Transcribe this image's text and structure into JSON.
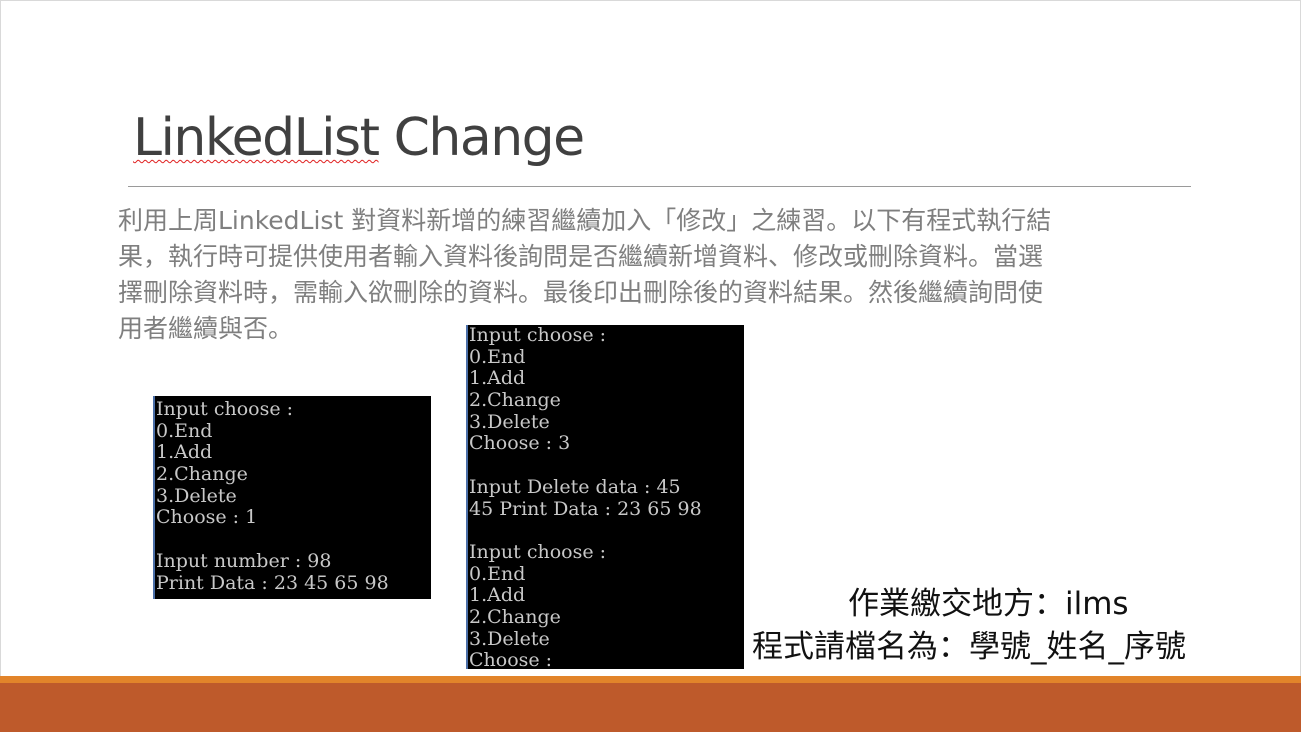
{
  "slide": {
    "title_underlined": "LinkedList",
    "title_rest": " Change",
    "body_lines": [
      "利用上周LinkedList 對資料新增的練習繼續加入「修改」之練習。以下有程式執行結",
      "果，執行時可提供使用者輸入資料後詢問是否繼續新增資料、修改或刪除資料。當選",
      "擇刪除資料時，需輸入欲刪除的資料。最後印出刪除後的資料結果。然後繼續詢問使",
      "用者繼續與否。"
    ],
    "console_1": [
      "Input choose :",
      "0.End",
      "1.Add",
      "2.Change",
      "3.Delete",
      "Choose : 1",
      "",
      "Input number : 98",
      "Print Data : 23 45 65 98"
    ],
    "console_2": [
      "Input choose :",
      "0.End",
      "1.Add",
      "2.Change",
      "3.Delete",
      "Choose : 3",
      "",
      "Input Delete data : 45",
      "45 Print Data : 23 65 98",
      "",
      "Input choose :",
      "0.End",
      "1.Add",
      "2.Change",
      "3.Delete",
      "Choose :"
    ],
    "submit_place": "作業繳交地方：ilms",
    "file_naming": "程式請檔名為：學號_姓名_序號"
  },
  "colors": {
    "accent_bar": "#e2842a",
    "footer_band": "#be5a2b",
    "console_bg": "#000000"
  }
}
